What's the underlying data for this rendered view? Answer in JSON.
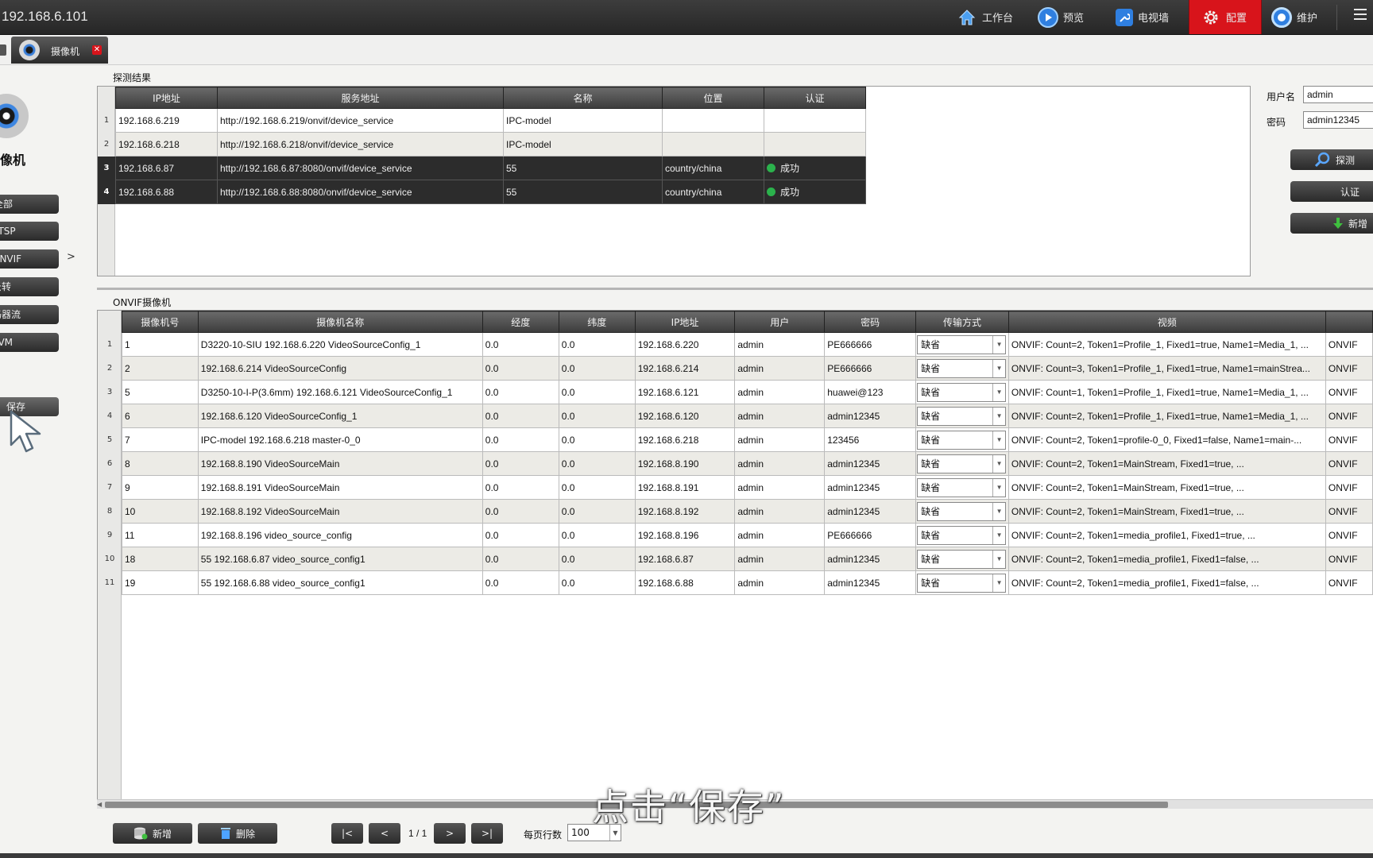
{
  "topbar": {
    "ip": "192.168.6.101",
    "nav": [
      {
        "label": "工作台",
        "icon": "home-icon"
      },
      {
        "label": "预览",
        "icon": "play-icon"
      },
      {
        "label": "电视墙",
        "icon": "wrench-icon"
      },
      {
        "label": "配置",
        "icon": "gear-icon",
        "active": true
      },
      {
        "label": "维护",
        "icon": "ring-icon"
      }
    ],
    "accent_color": "#d8141b"
  },
  "tab": {
    "label": "摄像机"
  },
  "sidebar": {
    "title": "像机",
    "items": [
      "全部",
      "RTSP",
      "ONVIF",
      "云转",
      "编码器流",
      "AVM"
    ],
    "arrow": ">",
    "save_label": "保存"
  },
  "detect": {
    "section_label": "探测结果",
    "columns": [
      "IP地址",
      "服务地址",
      "名称",
      "位置",
      "认证"
    ],
    "rows": [
      {
        "n": "1",
        "ip": "192.168.6.219",
        "service": "http://192.168.6.219/onvif/device_service",
        "name": "IPC-model",
        "location": "",
        "auth": "",
        "dark": false
      },
      {
        "n": "2",
        "ip": "192.168.6.218",
        "service": "http://192.168.6.218/onvif/device_service",
        "name": "IPC-model",
        "location": "",
        "auth": "",
        "dark": false
      },
      {
        "n": "3",
        "ip": "192.168.6.87",
        "service": "http://192.168.6.87:8080/onvif/device_service",
        "name": "55",
        "location": "country/china",
        "auth": "成功",
        "dark": true
      },
      {
        "n": "4",
        "ip": "192.168.6.88",
        "service": "http://192.168.6.88:8080/onvif/device_service",
        "name": "55",
        "location": "country/china",
        "auth": "成功",
        "dark": true
      }
    ]
  },
  "auth_form": {
    "username_label": "用户名",
    "username_value": "admin",
    "password_label": "密码",
    "password_value": "admin12345",
    "detect_button": "探测",
    "auth_button": "认证",
    "add_button": "新增"
  },
  "onvif": {
    "section_label": "ONVIF摄像机",
    "columns": [
      "摄像机号",
      "摄像机名称",
      "经度",
      "纬度",
      "IP地址",
      "用户",
      "密码",
      "传输方式",
      "视频",
      ""
    ],
    "rows": [
      {
        "n": "1",
        "id": "1",
        "name": "D3220-10-SIU 192.168.6.220 VideoSourceConfig_1",
        "lon": "0.0",
        "lat": "0.0",
        "ip": "192.168.6.220",
        "user": "admin",
        "pwd": "PE666666",
        "transport": "缺省",
        "video": "ONVIF: Count=2, Token1=Profile_1, Fixed1=true, Name1=Media_1, ...",
        "extra": "ONVIF"
      },
      {
        "n": "2",
        "id": "2",
        "name": "192.168.6.214 VideoSourceConfig",
        "lon": "0.0",
        "lat": "0.0",
        "ip": "192.168.6.214",
        "user": "admin",
        "pwd": "PE666666",
        "transport": "缺省",
        "video": "ONVIF: Count=3, Token1=Profile_1, Fixed1=true, Name1=mainStrea...",
        "extra": "ONVIF"
      },
      {
        "n": "3",
        "id": "5",
        "name": "D3250-10-I-P(3.6mm) 192.168.6.121 VideoSourceConfig_1",
        "lon": "0.0",
        "lat": "0.0",
        "ip": "192.168.6.121",
        "user": "admin",
        "pwd": "huawei@123",
        "transport": "缺省",
        "video": "ONVIF: Count=1, Token1=Profile_1, Fixed1=true, Name1=Media_1, ...",
        "extra": "ONVIF"
      },
      {
        "n": "4",
        "id": "6",
        "name": "192.168.6.120 VideoSourceConfig_1",
        "lon": "0.0",
        "lat": "0.0",
        "ip": "192.168.6.120",
        "user": "admin",
        "pwd": "admin12345",
        "transport": "缺省",
        "video": "ONVIF: Count=2, Token1=Profile_1, Fixed1=true, Name1=Media_1, ...",
        "extra": "ONVIF"
      },
      {
        "n": "5",
        "id": "7",
        "name": "IPC-model 192.168.6.218 master-0_0",
        "lon": "0.0",
        "lat": "0.0",
        "ip": "192.168.6.218",
        "user": "admin",
        "pwd": "123456",
        "transport": "缺省",
        "video": "ONVIF: Count=2, Token1=profile-0_0, Fixed1=false, Name1=main-...",
        "extra": "ONVIF"
      },
      {
        "n": "6",
        "id": "8",
        "name": "192.168.8.190 VideoSourceMain",
        "lon": "0.0",
        "lat": "0.0",
        "ip": "192.168.8.190",
        "user": "admin",
        "pwd": "admin12345",
        "transport": "缺省",
        "video": "ONVIF: Count=2, Token1=MainStream, Fixed1=true, ...",
        "extra": "ONVIF"
      },
      {
        "n": "7",
        "id": "9",
        "name": "192.168.8.191 VideoSourceMain",
        "lon": "0.0",
        "lat": "0.0",
        "ip": "192.168.8.191",
        "user": "admin",
        "pwd": "admin12345",
        "transport": "缺省",
        "video": "ONVIF: Count=2, Token1=MainStream, Fixed1=true, ...",
        "extra": "ONVIF"
      },
      {
        "n": "8",
        "id": "10",
        "name": "192.168.8.192 VideoSourceMain",
        "lon": "0.0",
        "lat": "0.0",
        "ip": "192.168.8.192",
        "user": "admin",
        "pwd": "admin12345",
        "transport": "缺省",
        "video": "ONVIF: Count=2, Token1=MainStream, Fixed1=true, ...",
        "extra": "ONVIF"
      },
      {
        "n": "9",
        "id": "11",
        "name": "192.168.8.196 video_source_config",
        "lon": "0.0",
        "lat": "0.0",
        "ip": "192.168.8.196",
        "user": "admin",
        "pwd": "PE666666",
        "transport": "缺省",
        "video": "ONVIF: Count=2, Token1=media_profile1, Fixed1=true, ...",
        "extra": "ONVIF"
      },
      {
        "n": "10",
        "id": "18",
        "name": "55 192.168.6.87 video_source_config1",
        "lon": "0.0",
        "lat": "0.0",
        "ip": "192.168.6.87",
        "user": "admin",
        "pwd": "admin12345",
        "transport": "缺省",
        "video": "ONVIF: Count=2, Token1=media_profile1, Fixed1=false, ...",
        "extra": "ONVIF"
      },
      {
        "n": "11",
        "id": "19",
        "name": "55 192.168.6.88 video_source_config1",
        "lon": "0.0",
        "lat": "0.0",
        "ip": "192.168.6.88",
        "user": "admin",
        "pwd": "admin12345",
        "transport": "缺省",
        "video": "ONVIF: Count=2, Token1=media_profile1, Fixed1=false, ...",
        "extra": "ONVIF"
      }
    ]
  },
  "footer": {
    "add_button": "新增",
    "delete_button": "删除",
    "first": "|<",
    "prev": "<",
    "page": "1 / 1",
    "next": ">",
    "last": ">|",
    "per_page_label": "每页行数",
    "per_page_value": "100"
  },
  "subtitle": "点击“保存”"
}
